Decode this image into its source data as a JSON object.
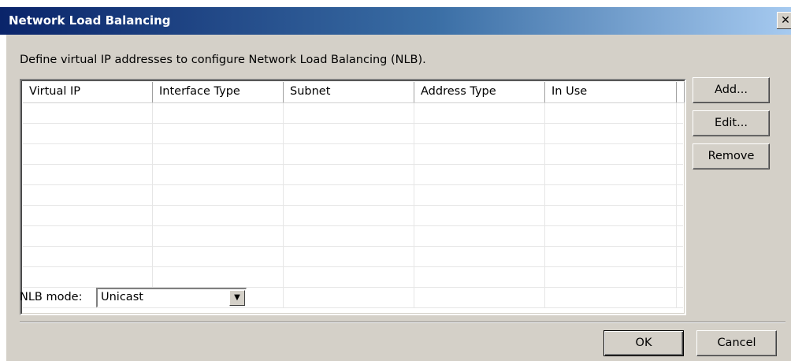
{
  "window": {
    "title": "Network Load Balancing",
    "close_glyph": "✕"
  },
  "dialog": {
    "description": "Define virtual IP addresses to configure Network Load Balancing (NLB).",
    "list": {
      "columns": [
        "Virtual IP",
        "Interface Type",
        "Subnet",
        "Address Type",
        "In Use"
      ],
      "rows": []
    },
    "side_buttons": {
      "add": "Add...",
      "edit": "Edit...",
      "remove": "Remove"
    },
    "nlb_mode": {
      "label": "NLB mode:",
      "value": "Unicast",
      "arrow_icon": "dropdown-arrow-icon"
    },
    "footer": {
      "ok": "OK",
      "cancel": "Cancel"
    }
  },
  "colors": {
    "titlebar_start": "#0a246a",
    "titlebar_end": "#a6caf0",
    "dialog_face": "#d4d0c8"
  }
}
